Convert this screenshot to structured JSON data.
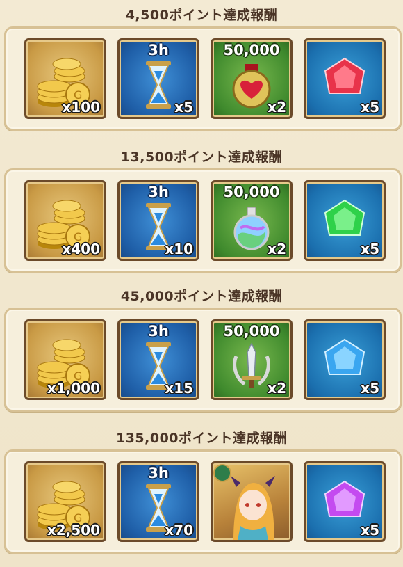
{
  "sections": [
    {
      "title": "4,500ポイント達成報酬",
      "rewards": [
        {
          "icon": "coin-stack-icon",
          "qty": "x100"
        },
        {
          "icon": "hourglass-icon",
          "label": "3h",
          "qty": "x5"
        },
        {
          "icon": "heart-medal-icon",
          "label": "50,000",
          "qty": "x2"
        },
        {
          "icon": "red-gem-icon",
          "qty": "x5"
        }
      ]
    },
    {
      "title": "13,500ポイント達成報酬",
      "rewards": [
        {
          "icon": "coin-stack-icon",
          "qty": "x400"
        },
        {
          "icon": "hourglass-icon",
          "label": "3h",
          "qty": "x10"
        },
        {
          "icon": "potion-flask-icon",
          "label": "50,000",
          "qty": "x2"
        },
        {
          "icon": "green-gem-icon",
          "qty": "x5"
        }
      ]
    },
    {
      "title": "45,000ポイント達成報酬",
      "rewards": [
        {
          "icon": "coin-stack-icon",
          "qty": "x1,000"
        },
        {
          "icon": "hourglass-icon",
          "label": "3h",
          "qty": "x15"
        },
        {
          "icon": "sword-emblem-icon",
          "label": "50,000",
          "qty": "x2"
        },
        {
          "icon": "blue-gem-icon",
          "qty": "x5"
        }
      ]
    },
    {
      "title": "135,000ポイント達成報酬",
      "rewards": [
        {
          "icon": "coin-stack-icon",
          "qty": "x2,500"
        },
        {
          "icon": "hourglass-icon",
          "label": "3h",
          "qty": "x70"
        },
        {
          "icon": "character-portrait-icon"
        },
        {
          "icon": "purple-gem-icon",
          "qty": "x5"
        }
      ]
    }
  ]
}
